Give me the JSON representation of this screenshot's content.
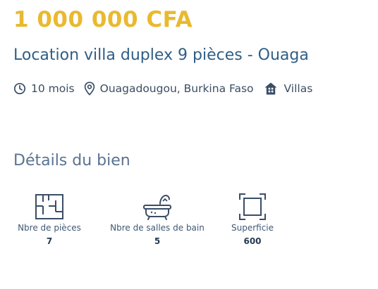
{
  "listing": {
    "price": "1 000 000 CFA",
    "title": "Location villa duplex 9 pièces - Ouaga",
    "meta": {
      "duration": "10 mois",
      "duration_icon": "clock-icon",
      "location": "Ouagadougou, Burkina Faso",
      "location_icon": "map-pin-icon",
      "category": "Villas",
      "category_icon": "house-icon"
    }
  },
  "details": {
    "section_title": "Détails du bien",
    "features": [
      {
        "label": "Nbre de pièces",
        "value": "7",
        "icon": "floor-plan-icon"
      },
      {
        "label": "Nbre de salles de bain",
        "value": "5",
        "icon": "bathtub-icon"
      },
      {
        "label": "Superficie",
        "value": "600",
        "icon": "area-frame-icon"
      }
    ]
  },
  "colors": {
    "price": "#e9b930",
    "title": "#2f5e86",
    "text": "#3b4d63",
    "icon_stroke": "#3a4d66"
  }
}
